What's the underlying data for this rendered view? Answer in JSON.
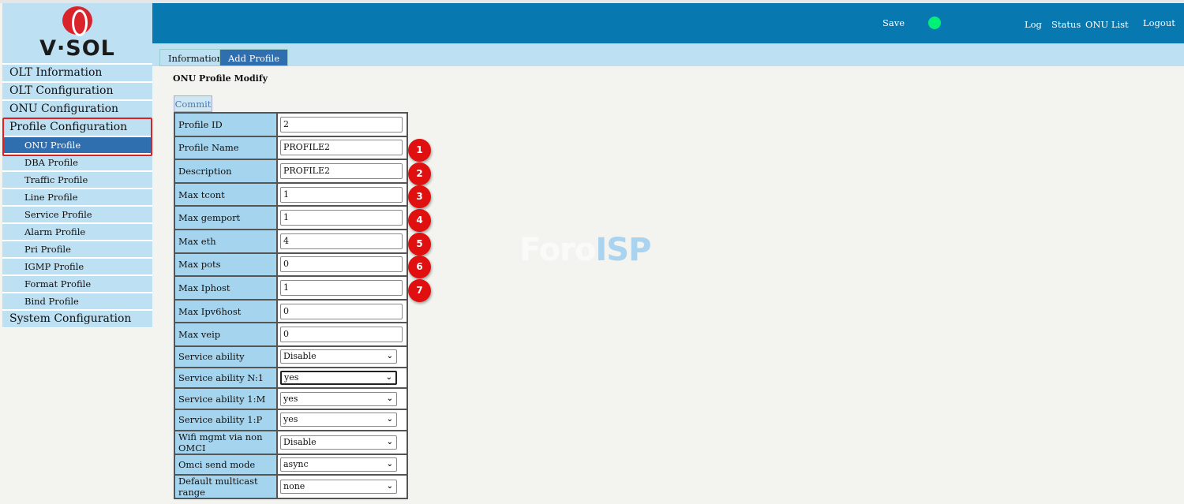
{
  "logo": {
    "text": "V·SOL"
  },
  "header": {
    "save": "Save",
    "status_dot_color": "#00f078",
    "links": [
      "Log",
      "Status",
      "ONU List"
    ],
    "logout": "Logout"
  },
  "tabs": [
    {
      "label": "Information",
      "active": false
    },
    {
      "label": "Add Profile",
      "active": true
    }
  ],
  "sidebar": {
    "main_top": [
      "OLT Information",
      "OLT Configuration",
      "ONU Configuration",
      "Profile Configuration"
    ],
    "sub": [
      "ONU Profile",
      "DBA Profile",
      "Traffic Profile",
      "Line Profile",
      "Service Profile",
      "Alarm Profile",
      "Pri Profile",
      "IGMP Profile",
      "Format Profile",
      "Bind Profile"
    ],
    "active_sub": "ONU Profile",
    "main_bottom": "System Configuration"
  },
  "page": {
    "title": "ONU Profile Modify",
    "commit": "Commit"
  },
  "fields": [
    {
      "label": "Profile ID",
      "value": "2"
    },
    {
      "label": "Profile Name",
      "value": "PROFILE2",
      "badge": "1"
    },
    {
      "label": "Description",
      "value": "PROFILE2",
      "badge": "2"
    },
    {
      "label": "Max tcont",
      "value": "1",
      "badge": "3"
    },
    {
      "label": "Max gemport",
      "value": "1",
      "badge": "4"
    },
    {
      "label": "Max eth",
      "value": "4",
      "badge": "5"
    },
    {
      "label": "Max pots",
      "value": "0",
      "badge": "6"
    },
    {
      "label": "Max Iphost",
      "value": "1",
      "badge": "7"
    },
    {
      "label": "Max Ipv6host",
      "value": "0"
    },
    {
      "label": "Max veip",
      "value": "0"
    }
  ],
  "selects": [
    {
      "label": "Service ability",
      "value": "Disable"
    },
    {
      "label": "Service ability N:1",
      "value": "yes"
    },
    {
      "label": "Service ability 1:M",
      "value": "yes"
    },
    {
      "label": "Service ability 1:P",
      "value": "yes"
    },
    {
      "label": "Wifi mgmt via non OMCI",
      "value": "Disable"
    },
    {
      "label": "Omci send mode",
      "value": "async"
    },
    {
      "label": "Default multicast range",
      "value": "none"
    }
  ],
  "watermark": {
    "part1": "Foro",
    "part2": "ISP"
  }
}
